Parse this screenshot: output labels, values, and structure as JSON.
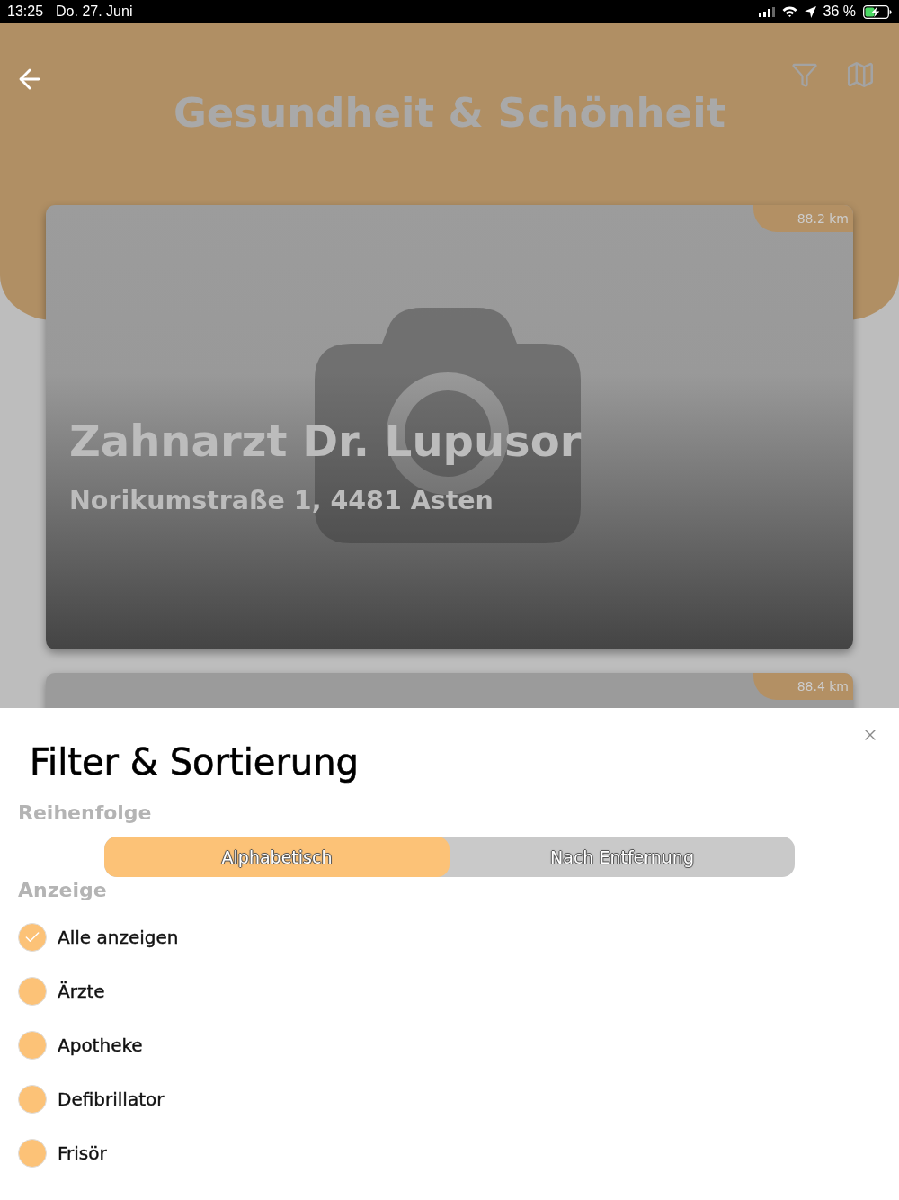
{
  "status_bar": {
    "time": "13:25",
    "date": "Do. 27. Juni",
    "battery": "36 %"
  },
  "header": {
    "title": "Gesundheit & Schönheit"
  },
  "places": [
    {
      "name": "Zahnarzt Dr. Lupusor",
      "address": "Norikumstraße 1, 4481 Asten",
      "distance": "88.2 km"
    },
    {
      "distance": "88.4 km"
    }
  ],
  "sheet": {
    "title": "Filter & Sortierung",
    "order_label": "Reihenfolge",
    "sort_options": [
      {
        "label": "Alphabetisch",
        "selected": true
      },
      {
        "label": "Nach Entfernung",
        "selected": false
      }
    ],
    "display_label": "Anzeige",
    "categories": [
      {
        "label": "Alle anzeigen",
        "checked": true
      },
      {
        "label": "Ärzte",
        "checked": false
      },
      {
        "label": "Apotheke",
        "checked": false
      },
      {
        "label": "Defibrillator",
        "checked": false
      },
      {
        "label": "Frisör",
        "checked": false
      }
    ]
  }
}
